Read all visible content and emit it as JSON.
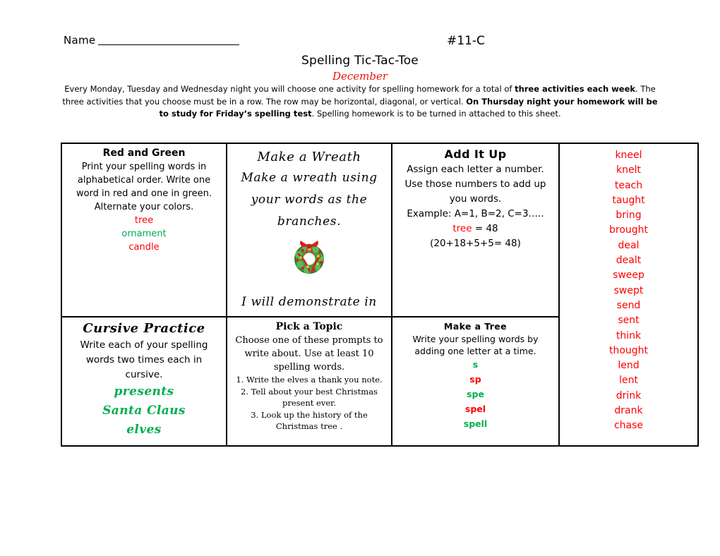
{
  "header": {
    "name_label": "Name",
    "sheet_code": "#11-C",
    "title": "Spelling Tic-Tac-Toe",
    "subtitle": "December",
    "intro_part1": "Every Monday, Tuesday and Wednesday night you will choose one activity for spelling homework for a total of ",
    "intro_bold1": "three activities each week",
    "intro_part2": ".  The three activities that you choose must be in a row.  The row may be horizontal, diagonal, or vertical.  ",
    "intro_bold2": "On Thursday night your homework will be to study for Friday’s spelling test",
    "intro_part3": ".  Spelling homework is to be turned in attached to this sheet."
  },
  "colors": {
    "red": "#ff0000",
    "green": "#00ad4f",
    "subtitle_red": "#ee1111",
    "border": "#000000"
  },
  "activities": {
    "red_and_green": {
      "title": "Red and Green",
      "body": "Print your spelling words in alphabetical order.  Write one word in red and one in green.  Alternate your colors.",
      "examples": [
        {
          "text": "tree",
          "color": "red"
        },
        {
          "text": "ornament",
          "color": "green"
        },
        {
          "text": "candle",
          "color": "red"
        }
      ]
    },
    "make_a_wreath": {
      "title": "Make a Wreath",
      "body": "Make a wreath using your words as the branches.",
      "icon": "wreath-icon",
      "closing": "I will demonstrate in class."
    },
    "add_it_up": {
      "title": "Add It Up",
      "line1": "Assign each letter a number.  Use those numbers to add up you words.",
      "line2": "Example:   A=1, B=2, C=3…..",
      "example_word": "tree",
      "example_sum": " = 48",
      "example_math": "(20+18+5+5= 48)"
    },
    "cursive_practice": {
      "title": "Cursive Practice",
      "body": "Write each of your spelling words two times each in cursive.",
      "examples": [
        {
          "text": "presents",
          "color": "green"
        },
        {
          "text": "Santa Claus",
          "color": "green"
        },
        {
          "text": "elves",
          "color": "green"
        }
      ]
    },
    "pick_a_topic": {
      "title": "Pick a Topic",
      "body": "Choose one of these prompts to write about.  Use at least 10 spelling words.",
      "prompts": [
        "1.  Write the elves a thank you note.",
        "2.  Tell about your best Christmas present ever.",
        "3.  Look up the history of the Christmas tree ."
      ]
    },
    "make_a_tree": {
      "title": "Make a Tree",
      "body": "Write your spelling words by adding one letter at a time.",
      "examples": [
        {
          "text": "s",
          "color": "green"
        },
        {
          "text": "sp",
          "color": "red"
        },
        {
          "text": "spe",
          "color": "green"
        },
        {
          "text": "spel",
          "color": "red"
        },
        {
          "text": "spell",
          "color": "green"
        }
      ]
    }
  },
  "word_list": [
    "kneel",
    "knelt",
    "teach",
    "taught",
    "bring",
    "brought",
    "deal",
    "dealt",
    "sweep",
    "swept",
    "send",
    "sent",
    "think",
    "thought",
    "lend",
    "lent",
    "drink",
    "drank",
    "chase"
  ]
}
